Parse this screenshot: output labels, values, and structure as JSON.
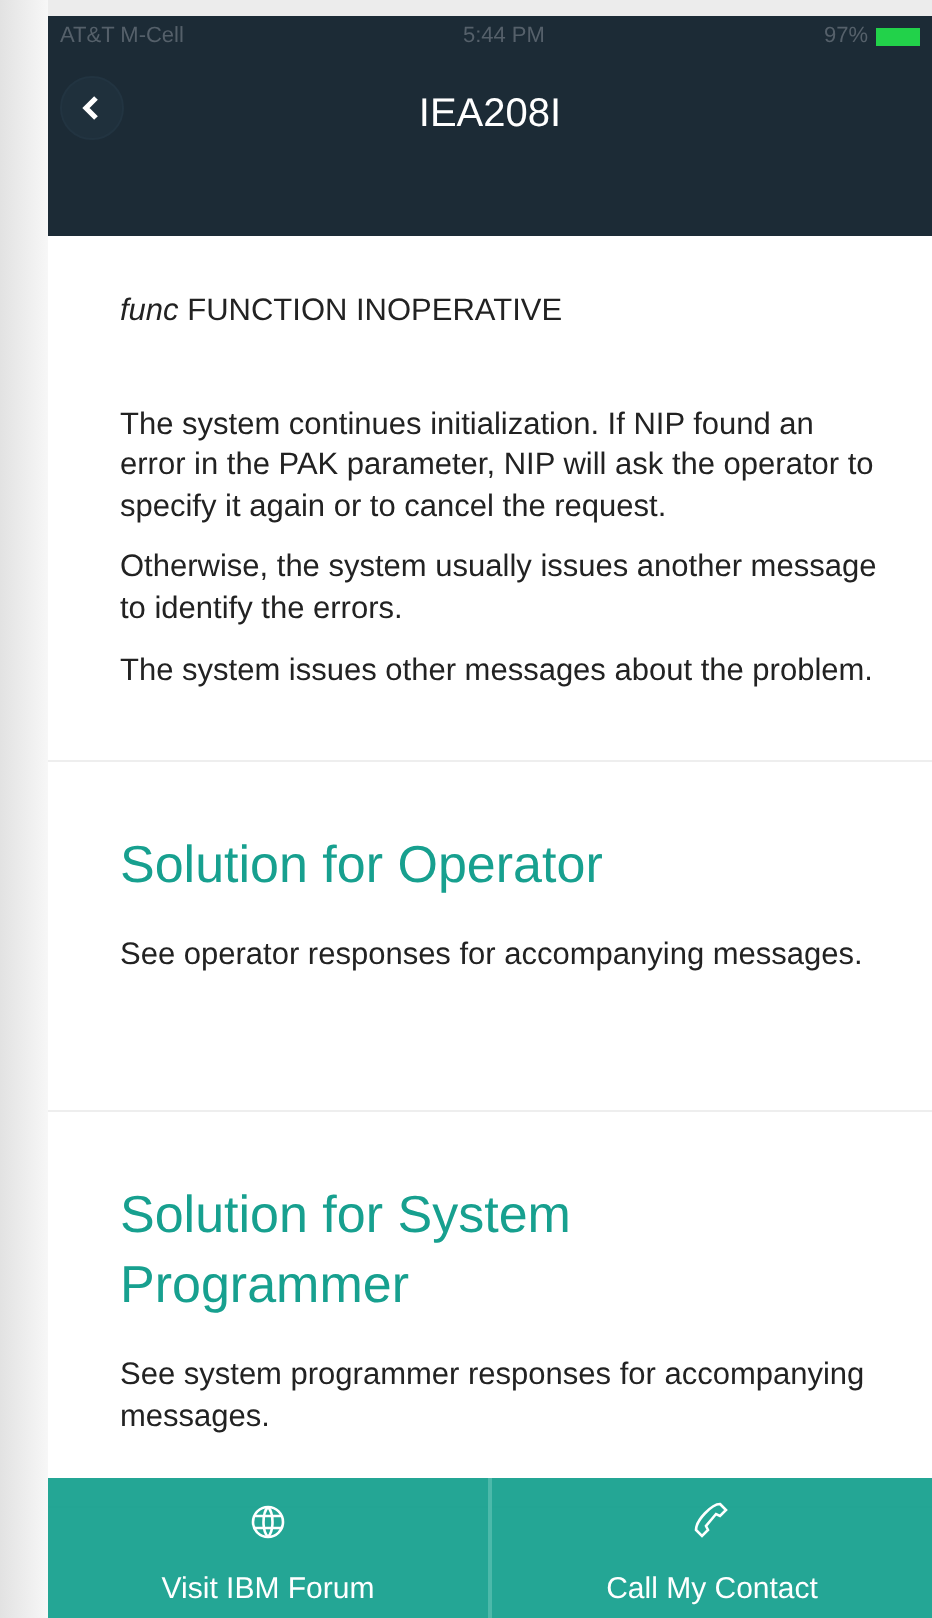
{
  "status_bar": {
    "carrier": "AT&T M-Cell",
    "time": "5:44 PM",
    "battery": "97%"
  },
  "header": {
    "title": "IEA208I"
  },
  "intro": {
    "lead": "*func* FUNCTION INOPERATIVE",
    "paragraphs": [
      "The system continues initialization. If NIP found an error in the PAK parameter, NIP will ask the operator to specify it again or to cancel the request.",
      "Otherwise, the system usually issues another message to identify the errors.",
      "The system issues other messages about the problem."
    ]
  },
  "sections": [
    {
      "heading": "Solution for Operator",
      "text": "See operator responses for accompanying messages."
    },
    {
      "heading": "Solution for System Programmer",
      "text": "See system programmer responses for accompanying messages."
    }
  ],
  "footer": [
    {
      "kind": "globe",
      "label": "Visit IBM Forum"
    },
    {
      "kind": "phone",
      "label": "Call My Contact"
    }
  ]
}
